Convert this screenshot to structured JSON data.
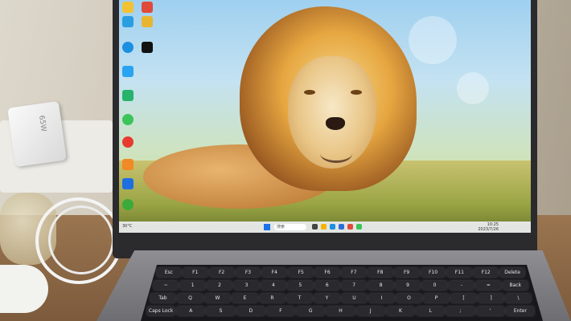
{
  "scene": {
    "description_labels": [],
    "charger_text": "65W"
  },
  "taskbar": {
    "search_placeholder": "搜索",
    "weather": "30°C",
    "time": "10:25",
    "date": "2023/7/26"
  },
  "keyboard": {
    "row1": [
      "Esc",
      "F1",
      "F2",
      "F3",
      "F4",
      "F5",
      "F6",
      "F7",
      "F8",
      "F9",
      "F10",
      "F11",
      "F12",
      "Delete"
    ],
    "row2": [
      "~",
      "1",
      "2",
      "3",
      "4",
      "5",
      "6",
      "7",
      "8",
      "9",
      "0",
      "-",
      "=",
      "Back"
    ],
    "row3": [
      "Tab",
      "Q",
      "W",
      "E",
      "R",
      "T",
      "Y",
      "U",
      "I",
      "O",
      "P",
      "[",
      "]",
      "\\"
    ],
    "row4": [
      "Caps Lock",
      "A",
      "S",
      "D",
      "F",
      "G",
      "H",
      "J",
      "K",
      "L",
      ";",
      "'",
      "Enter"
    ]
  },
  "colors": {
    "lid": "#2b2b2e",
    "taskbar": "#ebeef2",
    "start_blue": "#1a73e8"
  }
}
